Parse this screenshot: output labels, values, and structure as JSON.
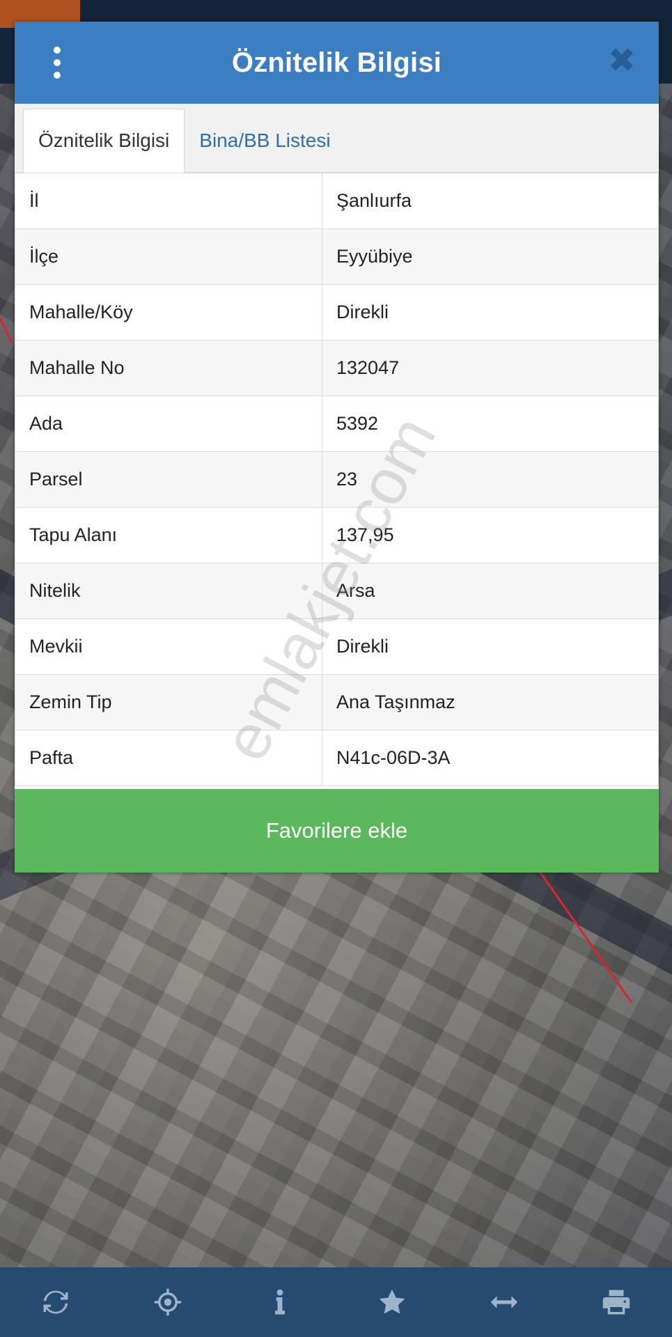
{
  "dialog": {
    "title": "Öznitelik Bilgisi",
    "close_symbol": "✖",
    "tabs": [
      {
        "label": "Öznitelik Bilgisi",
        "active": true
      },
      {
        "label": "Bina/BB Listesi",
        "active": false
      }
    ],
    "rows": [
      {
        "key": "İl",
        "value": "Şanlıurfa"
      },
      {
        "key": "İlçe",
        "value": "Eyyübiye"
      },
      {
        "key": "Mahalle/Köy",
        "value": "Direkli"
      },
      {
        "key": "Mahalle No",
        "value": "132047"
      },
      {
        "key": "Ada",
        "value": "5392"
      },
      {
        "key": "Parsel",
        "value": "23"
      },
      {
        "key": "Tapu Alanı",
        "value": "137,95"
      },
      {
        "key": "Nitelik",
        "value": "Arsa"
      },
      {
        "key": "Mevkii",
        "value": "Direkli"
      },
      {
        "key": "Zemin Tip",
        "value": "Ana Taşınmaz"
      },
      {
        "key": "Pafta",
        "value": "N41c-06D-3A"
      }
    ],
    "favorite_label": "Favorilere ekle"
  },
  "watermark": "emlakjet.com",
  "toolbar": {
    "icons": [
      "refresh-icon",
      "crosshair-icon",
      "info-icon",
      "star-icon",
      "arrows-horizontal-icon",
      "print-icon"
    ]
  },
  "colors": {
    "header": "#3b7fc2",
    "favorite": "#5cb85c",
    "toolbar": "#264a70",
    "tab_inactive_text": "#2f6fa8"
  }
}
